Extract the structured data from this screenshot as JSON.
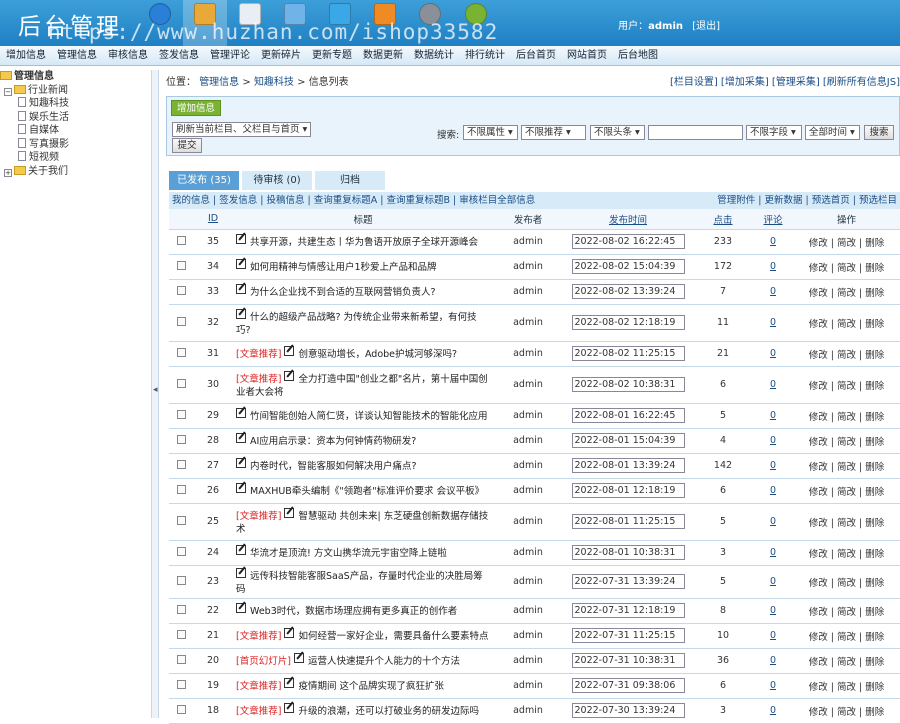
{
  "header": {
    "logo": "后台管理",
    "watermark": "https://www.huzhan.com/ishop33582",
    "user_label": "用户：",
    "user_name": "admin",
    "logout": "[退出]",
    "icons": [
      {
        "name": "globe-icon",
        "color": "#2a7fd6"
      },
      {
        "name": "edit-doc-icon",
        "color": "#e8a93a"
      },
      {
        "name": "folder-icon",
        "color": "#e9eef4"
      },
      {
        "name": "window-icon",
        "color": "#6fb3e8"
      },
      {
        "name": "user-icon",
        "color": "#3aa7e6"
      },
      {
        "name": "ruler-icon",
        "color": "#f08a24"
      },
      {
        "name": "gear-icon",
        "color": "#8a9099"
      },
      {
        "name": "plus-circle-icon",
        "color": "#7ab234"
      }
    ],
    "icon_labels": [
      "",
      "",
      "",
      "",
      "",
      "",
      "",
      ""
    ]
  },
  "nav": [
    "增加信息",
    "管理信息",
    "审核信息",
    "签发信息",
    "管理评论",
    "更新碎片",
    "更新专题",
    "数据更新",
    "数据统计",
    "排行统计",
    "后台首页",
    "网站首页",
    "后台地图"
  ],
  "sidebar": {
    "root": "管理信息",
    "industry": "行业新闻",
    "children": [
      "知趣科技",
      "娱乐生活",
      "自媒体",
      "写真摄影",
      "短视频"
    ],
    "about": "关于我们"
  },
  "crumbs": {
    "location": "位置：",
    "path": [
      "管理信息",
      "知趣科技",
      "信息列表"
    ],
    "right": "[栏目设置] [增加采集] [管理采集] [刷新所有信息JS]"
  },
  "toolbox": {
    "add": "增加信息",
    "refresh_select": "刷新当前栏目、父栏目与首页",
    "submit": "提交",
    "search_label": "搜索:",
    "filters": [
      "不限属性",
      "不限推荐",
      "不限头条"
    ],
    "field": "不限字段",
    "time": "全部时间",
    "search_btn": "搜索"
  },
  "tabs": [
    "已发布 (35)",
    "待审核 (0)",
    "归档"
  ],
  "actions": {
    "left": "我的信息 | 签发信息 | 投稿信息 | 查询重复标题A | 查询重复标题B | 审核栏目全部信息",
    "right": "管理附件 | 更新数据 | 预选首页 | 预选栏目"
  },
  "columns": {
    "id": "ID",
    "title": "标题",
    "author": "发布者",
    "time": "发布时间",
    "hits": "点击",
    "comments": "评论",
    "ops": "操作"
  },
  "ops_label": "修改 | 简改 | 删除",
  "rows": [
    {
      "id": "35",
      "tag": "",
      "title": "共享开源，共建生态丨华为鲁语开放原子全球开源峰会",
      "author": "admin",
      "time": "2022-08-02 16:22:45",
      "hits": "233",
      "comments": "0"
    },
    {
      "id": "34",
      "tag": "",
      "title": "如何用精神与情感让用户1秒爱上产品和品牌",
      "author": "admin",
      "time": "2022-08-02 15:04:39",
      "hits": "172",
      "comments": "0"
    },
    {
      "id": "33",
      "tag": "",
      "title": "为什么企业找不到合适的互联网营销负责人?",
      "author": "admin",
      "time": "2022-08-02 13:39:24",
      "hits": "7",
      "comments": "0"
    },
    {
      "id": "32",
      "tag": "",
      "title": "什么的超级产品战略? 为传统企业带来新希望，有何技巧?",
      "author": "admin",
      "time": "2022-08-02 12:18:19",
      "hits": "11",
      "comments": "0"
    },
    {
      "id": "31",
      "tag": "[文章推荐]",
      "title": "创意驱动增长，Adobe护城河够深吗?",
      "author": "admin",
      "time": "2022-08-02 11:25:15",
      "hits": "21",
      "comments": "0"
    },
    {
      "id": "30",
      "tag": "[文章推荐]",
      "title": "全力打造中国\"创业之都\"名片，第十届中国创业者大会将",
      "author": "admin",
      "time": "2022-08-02 10:38:31",
      "hits": "6",
      "comments": "0"
    },
    {
      "id": "29",
      "tag": "",
      "title": "竹间智能创始人简仁贤，详谈认知智能技术的智能化应用",
      "author": "admin",
      "time": "2022-08-01 16:22:45",
      "hits": "5",
      "comments": "0"
    },
    {
      "id": "28",
      "tag": "",
      "title": "AI应用启示录：资本为何钟情药物研发?",
      "author": "admin",
      "time": "2022-08-01 15:04:39",
      "hits": "4",
      "comments": "0"
    },
    {
      "id": "27",
      "tag": "",
      "title": "内卷时代，智能客服如何解决用户痛点?",
      "author": "admin",
      "time": "2022-08-01 13:39:24",
      "hits": "142",
      "comments": "0"
    },
    {
      "id": "26",
      "tag": "",
      "title": "MAXHUB牵头编制《\"领跑者\"标准评价要求 会议平板》",
      "author": "admin",
      "time": "2022-08-01 12:18:19",
      "hits": "6",
      "comments": "0"
    },
    {
      "id": "25",
      "tag": "[文章推荐]",
      "title": "智慧驱动 共创未来| 东芝硬盘创新数据存储技术",
      "author": "admin",
      "time": "2022-08-01 11:25:15",
      "hits": "5",
      "comments": "0"
    },
    {
      "id": "24",
      "tag": "",
      "title": "华流才是顶流! 方文山携华流元宇宙空降上链啦",
      "author": "admin",
      "time": "2022-08-01 10:38:31",
      "hits": "3",
      "comments": "0"
    },
    {
      "id": "23",
      "tag": "",
      "title": "远传科技智能客服SaaS产品，存量时代企业的决胜局筹码",
      "author": "admin",
      "time": "2022-07-31 13:39:24",
      "hits": "5",
      "comments": "0"
    },
    {
      "id": "22",
      "tag": "",
      "title": "Web3时代，数据市场理应拥有更多真正的创作者",
      "author": "admin",
      "time": "2022-07-31 12:18:19",
      "hits": "8",
      "comments": "0"
    },
    {
      "id": "21",
      "tag": "[文章推荐]",
      "title": "如何经营一家好企业，需要具备什么要素特点",
      "author": "admin",
      "time": "2022-07-31 11:25:15",
      "hits": "10",
      "comments": "0"
    },
    {
      "id": "20",
      "tag": "[首页幻灯片]",
      "title": "运营人快速提升个人能力的十个方法",
      "author": "admin",
      "time": "2022-07-31 10:38:31",
      "hits": "36",
      "comments": "0"
    },
    {
      "id": "19",
      "tag": "[文章推荐]",
      "title": "疫情期间 这个品牌实现了疯狂扩张",
      "author": "admin",
      "time": "2022-07-31 09:38:06",
      "hits": "6",
      "comments": "0"
    },
    {
      "id": "18",
      "tag": "[文章推荐]",
      "title": "升级的浪潮，还可以打破业务的研发边际吗",
      "author": "admin",
      "time": "2022-07-30 13:39:24",
      "hits": "3",
      "comments": "0"
    }
  ]
}
